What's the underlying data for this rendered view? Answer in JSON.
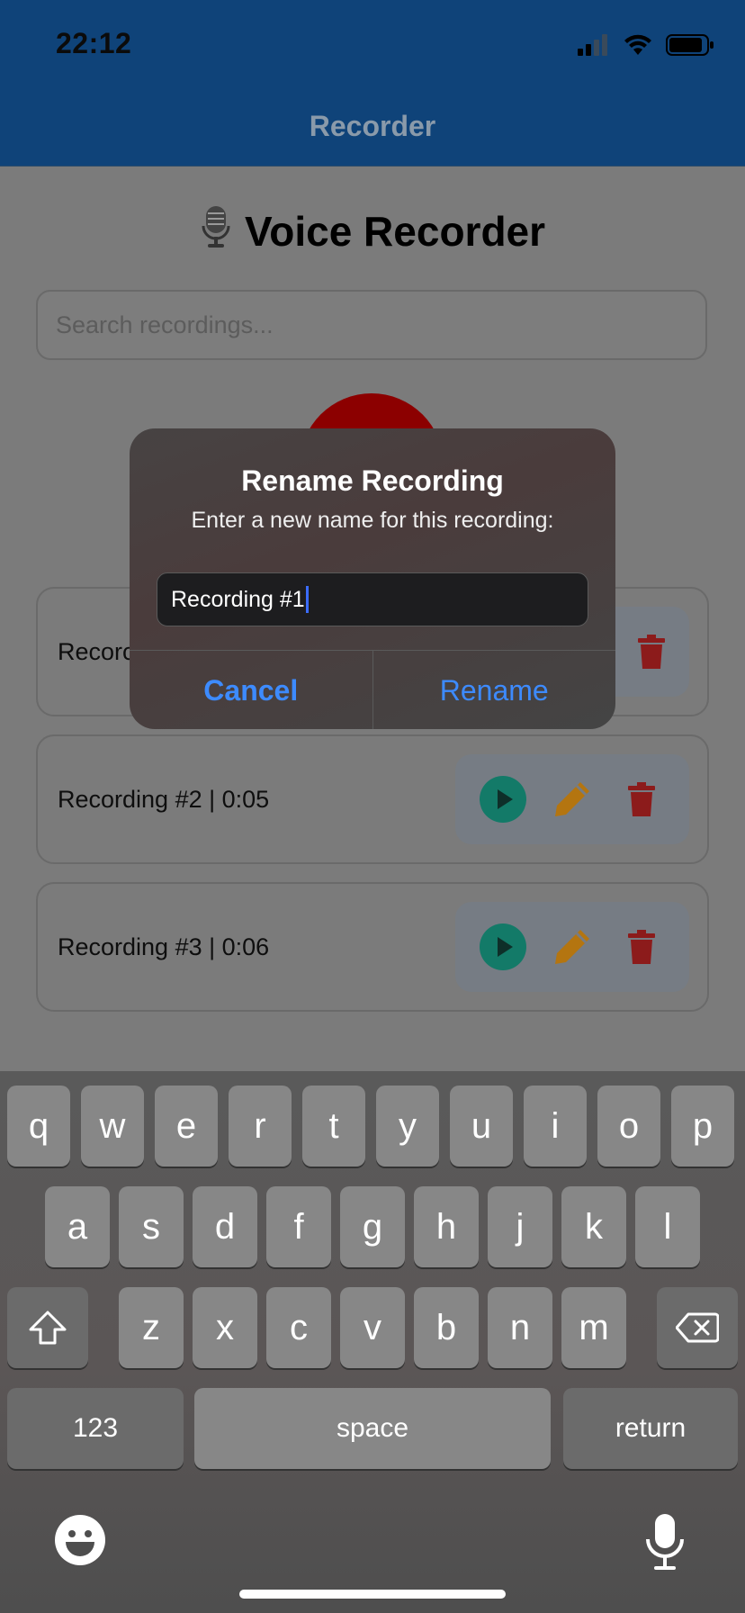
{
  "status": {
    "time": "22:12"
  },
  "nav": {
    "title": "Recorder"
  },
  "app": {
    "title": "Voice Recorder",
    "title_emoji": "🎙️"
  },
  "search": {
    "placeholder": "Search recordings..."
  },
  "recordings": [
    {
      "label": "Recording #1 | 0:04",
      "visible_label": "Recorc"
    },
    {
      "label": "Recording #2 | 0:05"
    },
    {
      "label": "Recording #3 | 0:06"
    }
  ],
  "dialog": {
    "title": "Rename Recording",
    "message": "Enter a new name for this recording:",
    "input_value": "Recording #1",
    "cancel_label": "Cancel",
    "rename_label": "Rename"
  },
  "keyboard": {
    "row1": [
      "q",
      "w",
      "e",
      "r",
      "t",
      "y",
      "u",
      "i",
      "o",
      "p"
    ],
    "row2": [
      "a",
      "s",
      "d",
      "f",
      "g",
      "h",
      "j",
      "k",
      "l"
    ],
    "row3": [
      "z",
      "x",
      "c",
      "v",
      "b",
      "n",
      "m"
    ],
    "numbers_label": "123",
    "space_label": "space",
    "return_label": "return"
  },
  "colors": {
    "nav_bg": "#0f4379",
    "play": "#137a68",
    "edit": "#b47510",
    "delete": "#8c1b1b",
    "dialog_button": "#3d8bff",
    "record": "#8c0000"
  }
}
